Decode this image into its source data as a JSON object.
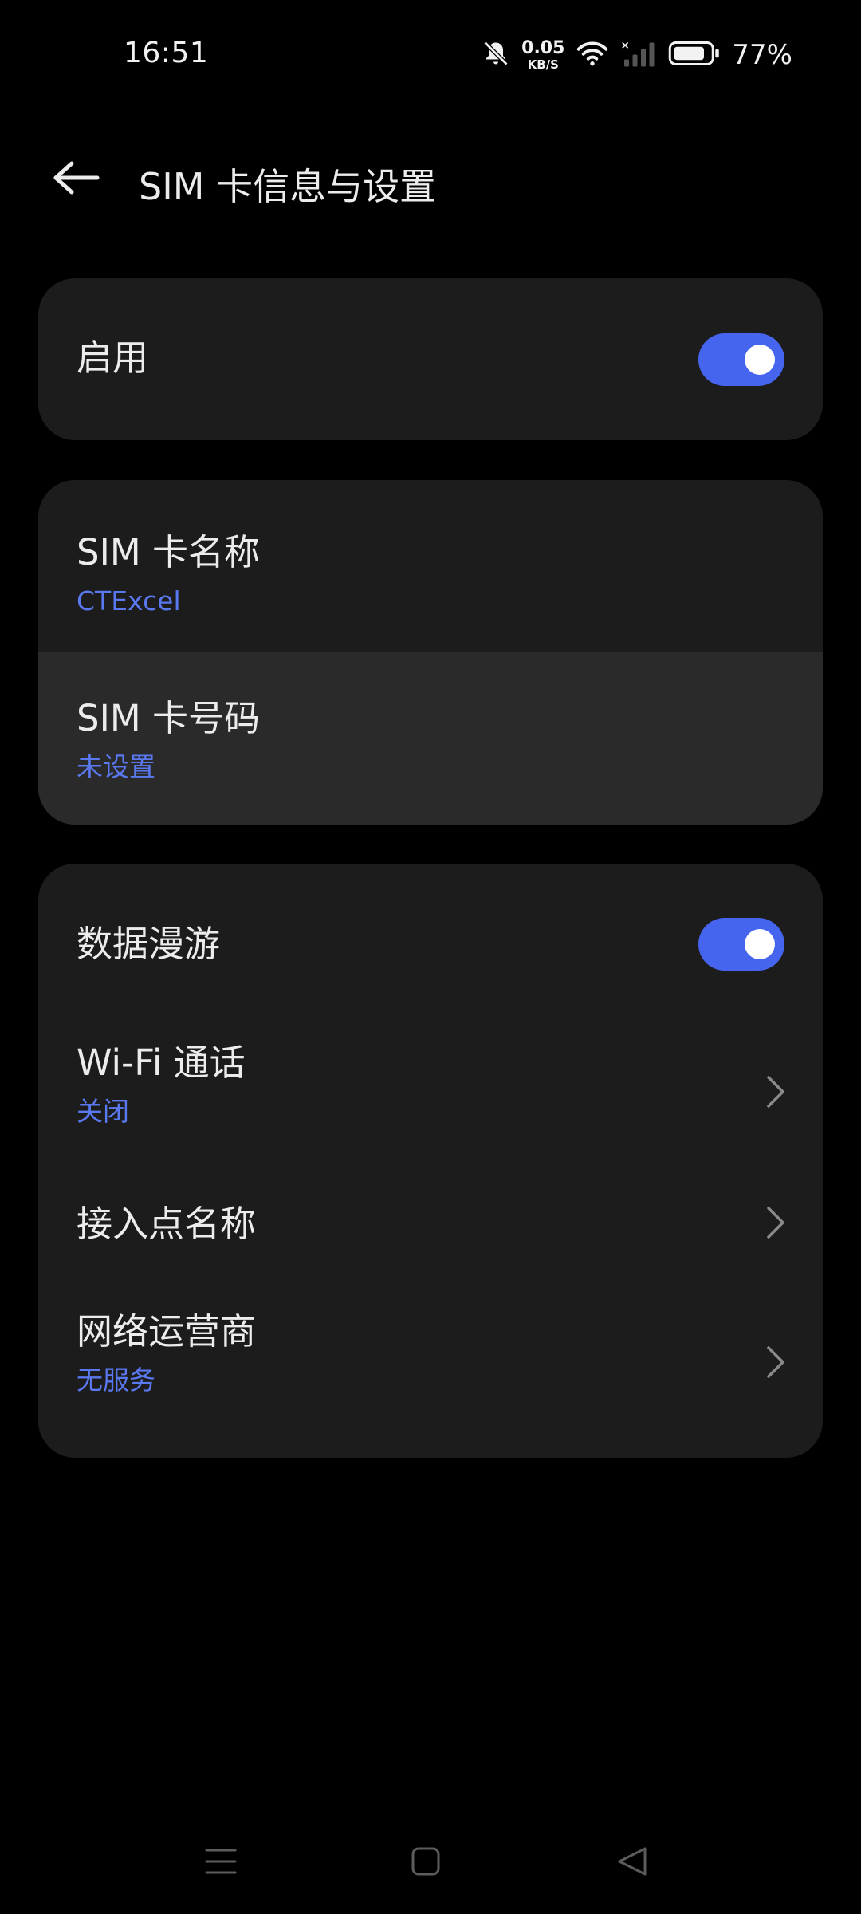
{
  "status_bar": {
    "time": "16:51",
    "net_speed_value": "0.05",
    "net_speed_unit": "KB/S",
    "battery_percent": "77%"
  },
  "header": {
    "title": "SIM 卡信息与设置"
  },
  "enable_card": {
    "label": "启用",
    "toggle_on": true
  },
  "sim_card": {
    "name_label": "SIM 卡名称",
    "name_value": "CTExcel",
    "number_label": "SIM 卡号码",
    "number_value": "未设置"
  },
  "network_card": {
    "roaming_label": "数据漫游",
    "roaming_on": true,
    "wifi_call_label": "Wi-Fi 通话",
    "wifi_call_value": "关闭",
    "apn_label": "接入点名称",
    "operator_label": "网络运营商",
    "operator_value": "无服务"
  },
  "colors": {
    "accent": "#4665ef",
    "link_text": "#5a78f0",
    "card_bg": "#1c1c1c",
    "card_bg_pressed": "#2a2a2a",
    "background": "#000000"
  },
  "icons": {
    "back": "arrow-left-icon",
    "chevron": "chevron-right-icon",
    "mute": "bell-off-icon",
    "wifi": "wifi-icon",
    "signal": "cellular-signal-off-icon",
    "battery": "battery-icon",
    "nav_menu": "menu-icon",
    "nav_home": "home-square-icon",
    "nav_back": "back-triangle-icon"
  }
}
